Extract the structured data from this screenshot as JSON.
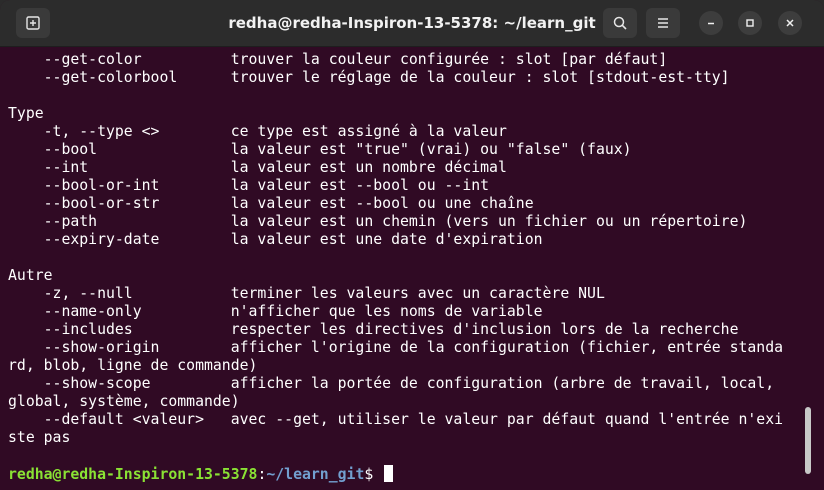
{
  "titlebar": {
    "title": "redha@redha-Inspiron-13-5378: ~/learn_git"
  },
  "icons": {
    "new_tab": "new-tab-icon",
    "search": "search-icon",
    "menu": "hamburger-menu-icon",
    "minimize": "minimize-icon",
    "maximize": "maximize-icon",
    "close": "close-icon"
  },
  "terminal": {
    "lines": [
      "    --get-color          trouver la couleur configurée : slot [par défaut]",
      "    --get-colorbool      trouver le réglage de la couleur : slot [stdout-est-tty]",
      "",
      "Type",
      "    -t, --type <>        ce type est assigné à la valeur",
      "    --bool               la valeur est \"true\" (vrai) ou \"false\" (faux)",
      "    --int                la valeur est un nombre décimal",
      "    --bool-or-int        la valeur est --bool ou --int",
      "    --bool-or-str        la valeur est --bool ou une chaîne",
      "    --path               la valeur est un chemin (vers un fichier ou un répertoire)",
      "    --expiry-date        la valeur est une date d'expiration",
      "",
      "Autre",
      "    -z, --null           terminer les valeurs avec un caractère NUL",
      "    --name-only          n'afficher que les noms de variable",
      "    --includes           respecter les directives d'inclusion lors de la recherche",
      "    --show-origin        afficher l'origine de la configuration (fichier, entrée standa",
      "rd, blob, ligne de commande)",
      "    --show-scope         afficher la portée de configuration (arbre de travail, local,",
      "global, système, commande)",
      "    --default <valeur>   avec --get, utiliser le valeur par défaut quand l'entrée n'exi",
      "ste pas",
      ""
    ],
    "prompt": {
      "user_host": "redha@redha-Inspiron-13-5378",
      "separator": ":",
      "path": "~/learn_git",
      "symbol": "$ "
    }
  },
  "colors": {
    "background": "#300a24",
    "prompt_user": "#8ae234",
    "prompt_path": "#729fcf",
    "titlebar": "#2c2c2c"
  }
}
